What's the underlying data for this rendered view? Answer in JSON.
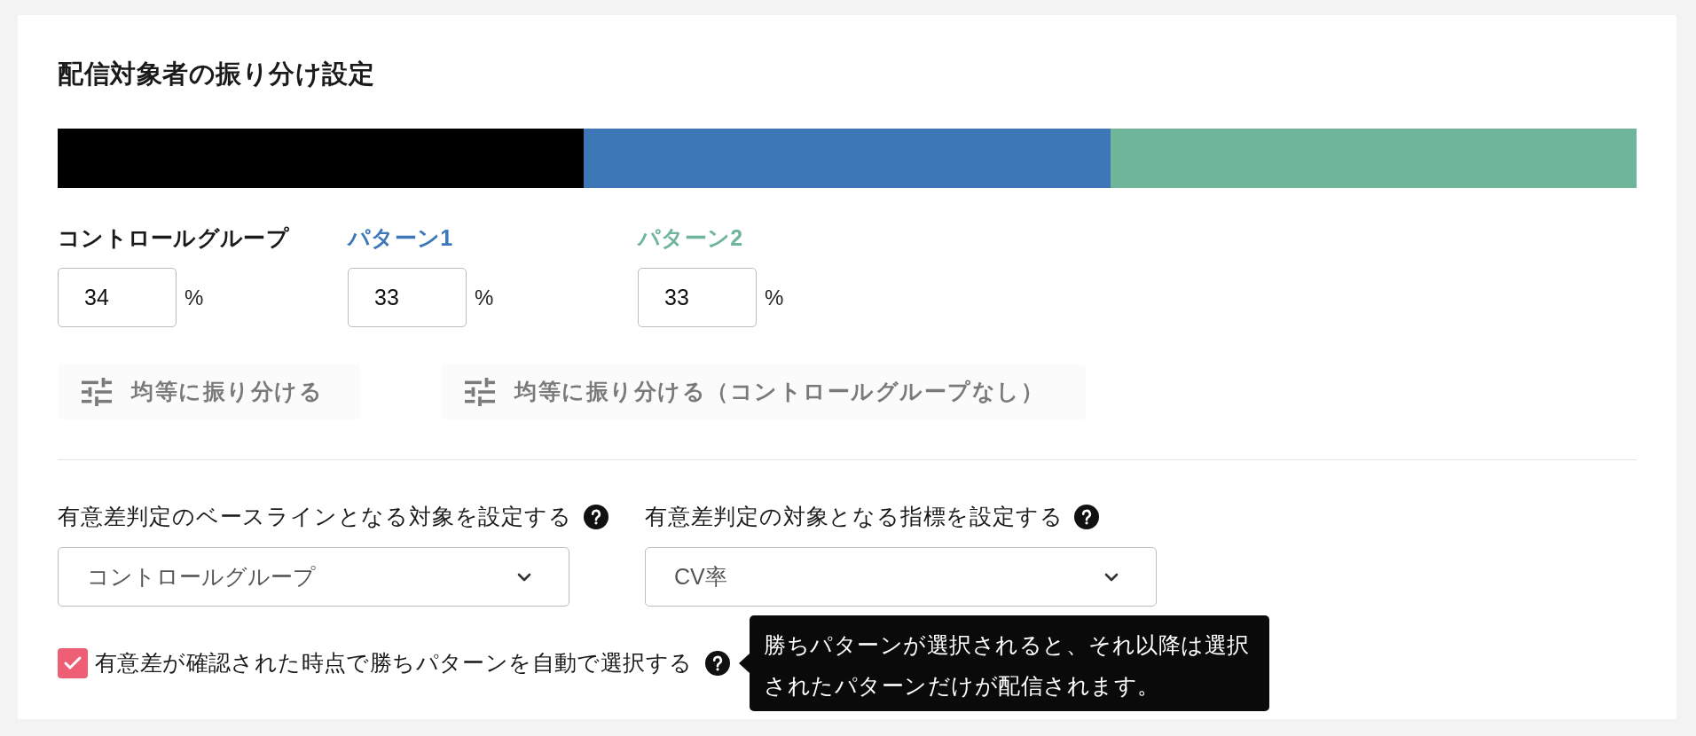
{
  "title": "配信対象者の振り分け設定",
  "bar": {
    "segments": [
      {
        "color": "#000000"
      },
      {
        "color": "#3d77b8"
      },
      {
        "color": "#6fb59a"
      }
    ]
  },
  "groups": [
    {
      "label": "コントロールグループ",
      "color": "#1a1a1a",
      "value": "34",
      "unit": "%"
    },
    {
      "label": "パターン1",
      "color": "#3d77b8",
      "value": "33",
      "unit": "%"
    },
    {
      "label": "パターン2",
      "color": "#6fb59a",
      "value": "33",
      "unit": "%"
    }
  ],
  "buttons": [
    "均等に振り分ける",
    "均等に振り分ける（コントロールグループなし）"
  ],
  "significance": {
    "fields": [
      {
        "label": "有意差判定のベースラインとなる対象を設定する",
        "value": "コントロールグループ"
      },
      {
        "label": "有意差判定の対象となる指標を設定する",
        "value": "CV率"
      }
    ],
    "auto_select": {
      "label": "有意差が確認された時点で勝ちパターンを自動で選択する",
      "checked": true,
      "tooltip": "勝ちパターンが選択されると、それ以降は選択されたパターンだけが配信されます。"
    }
  }
}
